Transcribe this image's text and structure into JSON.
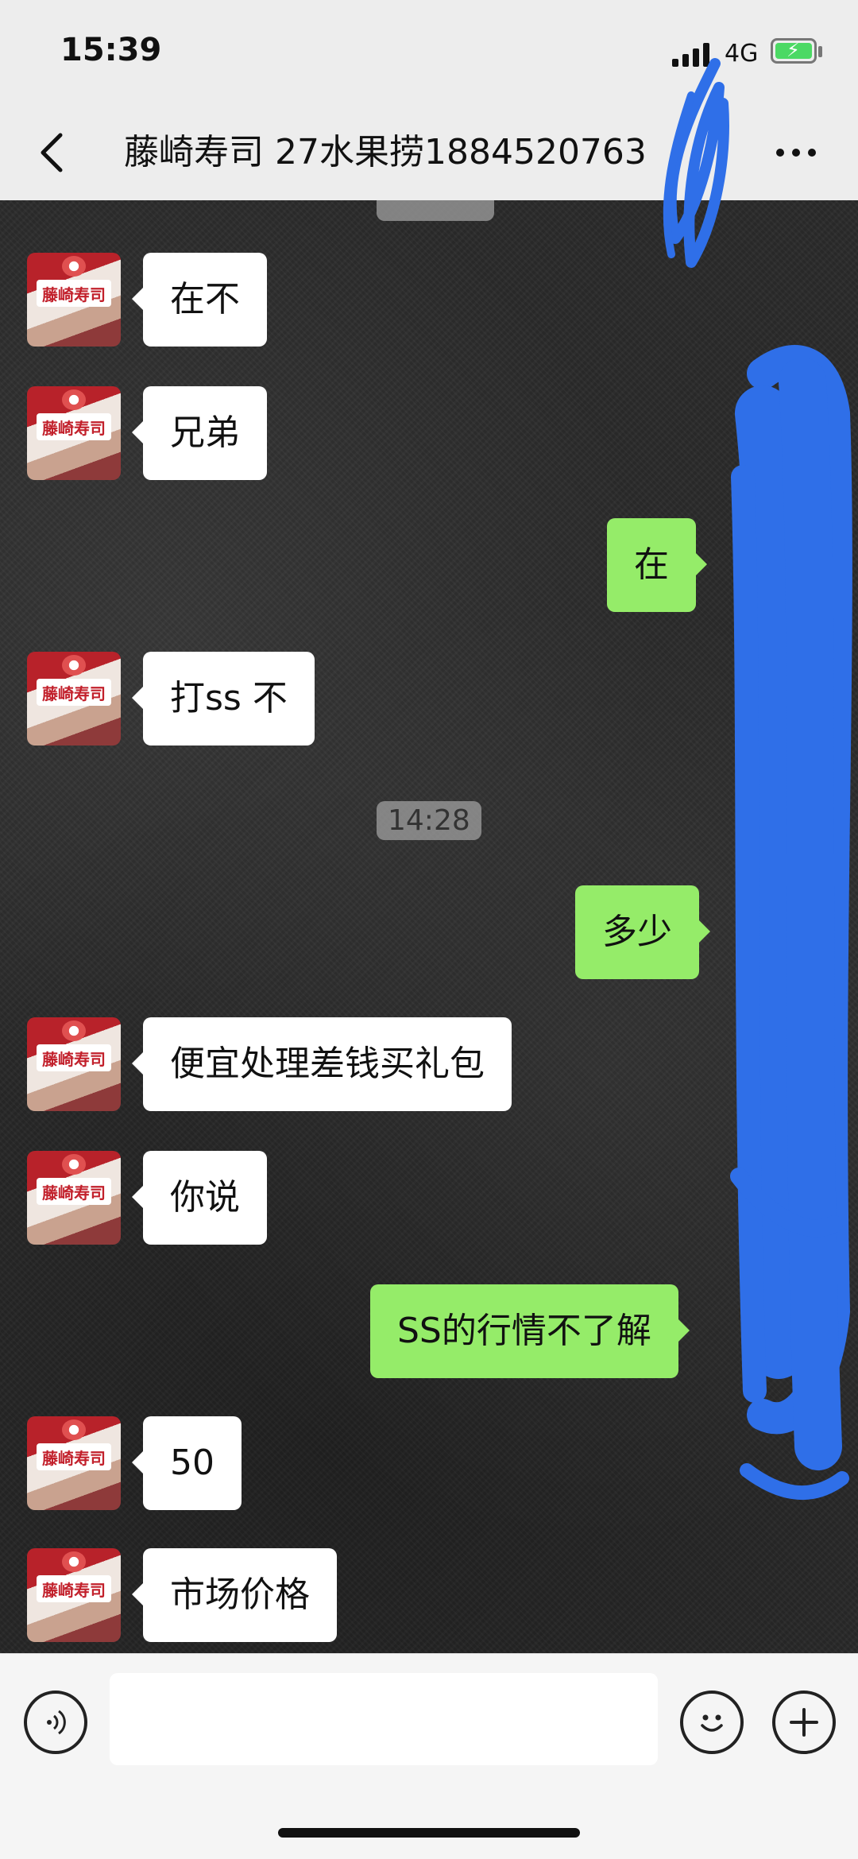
{
  "status_bar": {
    "time": "15:39",
    "network": "4G"
  },
  "header": {
    "title": "藤崎寿司 27水果捞1884520763",
    "back_icon": "chevron-left-icon",
    "more_icon": "more-dots-icon"
  },
  "chat": {
    "timestamps": [
      "14:28"
    ],
    "messages": [
      {
        "side": "in",
        "text": "在不"
      },
      {
        "side": "in",
        "text": "兄弟"
      },
      {
        "side": "out",
        "text": "在"
      },
      {
        "side": "in",
        "text": "打ss 不"
      },
      {
        "side": "out",
        "text": "多少"
      },
      {
        "side": "in",
        "text": "便宜处理差钱买礼包"
      },
      {
        "side": "in",
        "text": "你说"
      },
      {
        "side": "out",
        "text": "SS的行情不了解"
      },
      {
        "side": "in",
        "text": "50"
      },
      {
        "side": "in",
        "text": "市场价格"
      }
    ],
    "contact_avatar_text": "藤崎寿司"
  },
  "input_bar": {
    "voice_icon": "voice-icon",
    "emoji_icon": "emoji-icon",
    "plus_icon": "plus-icon",
    "placeholder": ""
  },
  "colors": {
    "outgoing_bubble": "#95ec69",
    "incoming_bubble": "#ffffff",
    "redaction": "#2f6fe8"
  }
}
